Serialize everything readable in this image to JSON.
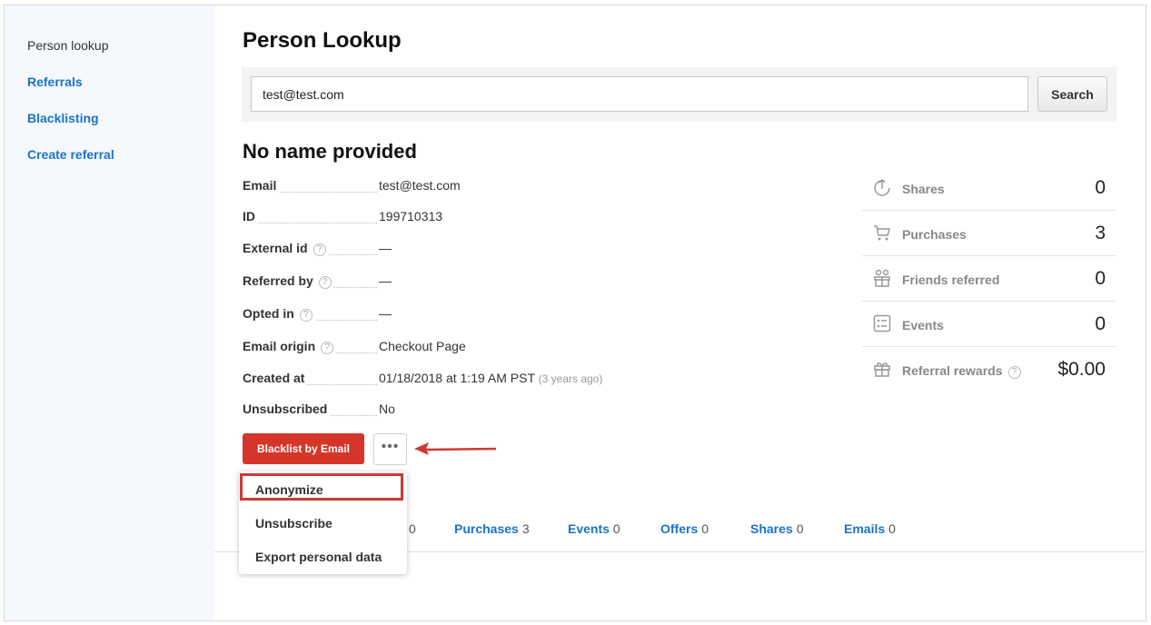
{
  "sidebar": {
    "items": [
      {
        "label": "Person lookup"
      },
      {
        "label": "Referrals"
      },
      {
        "label": "Blacklisting"
      },
      {
        "label": "Create referral"
      }
    ]
  },
  "page": {
    "title": "Person Lookup"
  },
  "search": {
    "value": "test@test.com",
    "button_label": "Search"
  },
  "person": {
    "name": "No name provided",
    "details": [
      {
        "label": "Email",
        "value": "test@test.com"
      },
      {
        "label": "ID",
        "value": "199710313"
      },
      {
        "label": "External id",
        "value": "—"
      },
      {
        "label": "Referred by",
        "value": "—"
      },
      {
        "label": "Opted in",
        "value": "—"
      },
      {
        "label": "Email origin",
        "value": "Checkout Page"
      },
      {
        "label": "Created at",
        "value": "01/18/2018 at 1:19 AM PST",
        "relative": "(3 years ago)"
      },
      {
        "label": "Unsubscribed",
        "value": "No"
      }
    ],
    "help_glyph": "?"
  },
  "stats": [
    {
      "label": "Shares",
      "value": "0",
      "icon": "share-icon"
    },
    {
      "label": "Purchases",
      "value": "3",
      "icon": "cart-icon"
    },
    {
      "label": "Friends referred",
      "value": "0",
      "icon": "friends-icon"
    },
    {
      "label": "Events",
      "value": "0",
      "icon": "events-icon"
    },
    {
      "label": "Referral rewards",
      "value": "$0.00",
      "icon": "gift-icon"
    }
  ],
  "actions": {
    "blacklist_label": "Blacklist by Email",
    "more_label": "•••"
  },
  "dropdown": {
    "items": [
      {
        "label": "Anonymize"
      },
      {
        "label": "Unsubscribe"
      },
      {
        "label": "Export personal data"
      }
    ]
  },
  "tabs": [
    {
      "label": "",
      "count": "0"
    },
    {
      "label": "Purchases",
      "count": "3"
    },
    {
      "label": "Events",
      "count": "0"
    },
    {
      "label": "Offers",
      "count": "0"
    },
    {
      "label": "Shares",
      "count": "0"
    },
    {
      "label": "Emails",
      "count": "0"
    }
  ],
  "colors": {
    "accent": "#1a73c9",
    "danger": "#d6352a",
    "annotation": "#cc3a32"
  }
}
